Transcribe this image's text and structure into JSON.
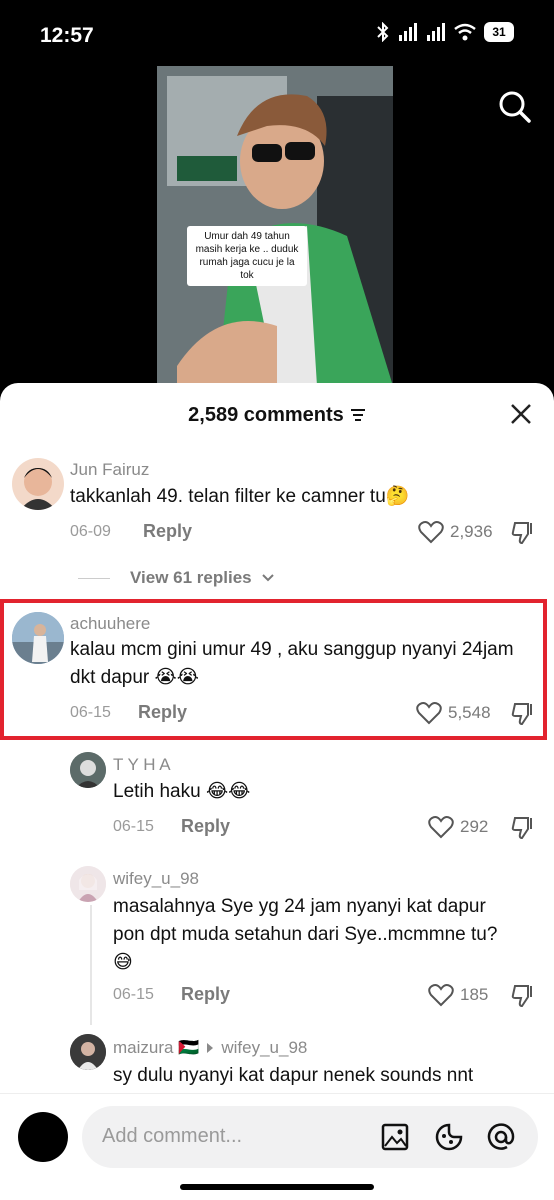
{
  "status": {
    "time": "12:57",
    "battery": "31"
  },
  "video": {
    "caption": "Umur dah 49 tahun masih kerja ke .. duduk rumah jaga cucu je la tok"
  },
  "sheet": {
    "title": "2,589 comments"
  },
  "comments": [
    {
      "username": "Jun Fairuz",
      "text": "takkanlah 49. telan filter ke camner tu🤔",
      "date": "06-09",
      "reply": "Reply",
      "likes": "2,936"
    },
    {
      "username": "achuuhere",
      "text": "kalau mcm gini umur 49 , aku sanggup nyanyi 24jam dkt dapur 😭😭",
      "date": "06-15",
      "reply": "Reply",
      "likes": "5,548"
    },
    {
      "username": "T Y H A",
      "text": "Letih haku 😂😂",
      "date": "06-15",
      "reply": "Reply",
      "likes": "292"
    },
    {
      "username": "wifey_u_98",
      "text": "masalahnya Sye yg 24 jam nyanyi kat dapur pon dpt muda setahun dari Sye..mcmmne tu?😅",
      "date": "06-15",
      "reply": "Reply",
      "likes": "185"
    },
    {
      "username": "maizura 🇵🇸",
      "reply_to": "wifey_u_98",
      "text": "sy dulu nyanyi kat dapur nenek sounds nnt"
    }
  ],
  "view_replies": "View 61 replies",
  "input": {
    "placeholder": "Add comment..."
  }
}
